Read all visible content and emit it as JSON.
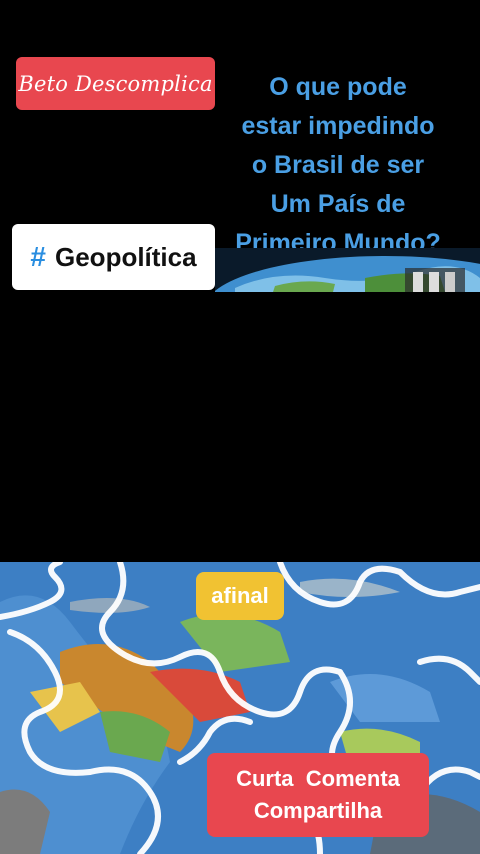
{
  "top_panel": {
    "brand_label": "Beto Descomplica",
    "headline_lines": [
      "O que pode",
      "estar impedindo",
      "o Brasil de ser",
      "Um País de",
      "Primeiro Mundo?"
    ],
    "tag": {
      "icon": "hash-icon",
      "symbol": "#",
      "label": "Geopolítica"
    }
  },
  "bottom_panel": {
    "word_badge": "afinal",
    "cta_lines": [
      "Curta  Comenta",
      "Compartilha"
    ]
  },
  "colors": {
    "background": "#000000",
    "brand_red": "#e8474f",
    "headline_blue": "#4a9fe4",
    "word_badge_yellow": "#f1c232",
    "map_ocean": "#3d7fc4"
  }
}
